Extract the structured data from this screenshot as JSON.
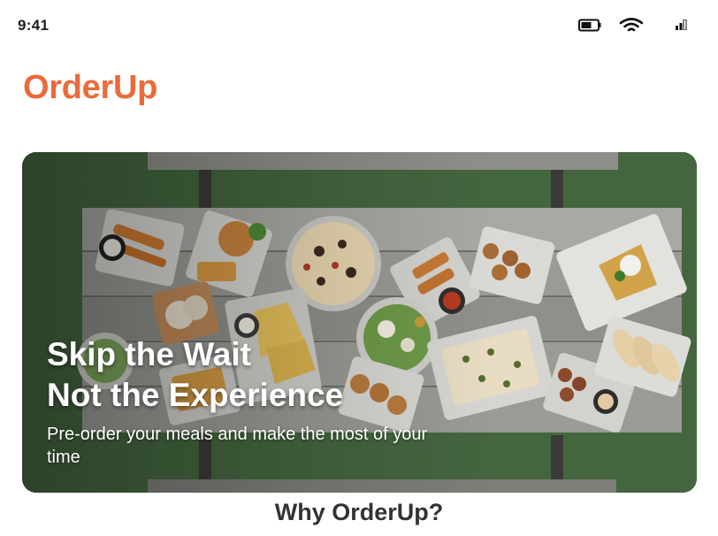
{
  "status_bar": {
    "time": "9:41",
    "icons": [
      "battery-icon",
      "wifi-icon",
      "signal-icon"
    ]
  },
  "brand": {
    "name": "OrderUp",
    "color": "#ec6a3a"
  },
  "hero": {
    "title_line1": "Skip the Wait",
    "title_line2": "Not the Experience",
    "subtitle": "Pre-order your meals and make the most of your time",
    "image": "food-on-picnic-table-photo"
  },
  "section": {
    "title": "Why OrderUp?"
  }
}
